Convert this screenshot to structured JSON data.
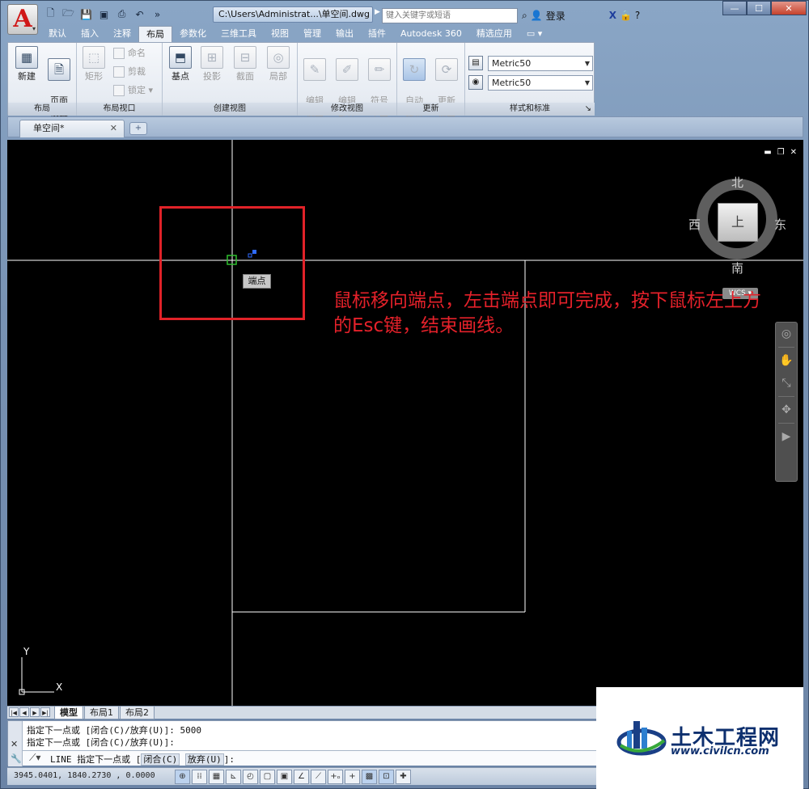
{
  "app": {
    "title": "C:\\Users\\Administrat...\\单空间.dwg",
    "search_placeholder": "键入关键字或短语",
    "login_label": "登录",
    "logo_letter": "A"
  },
  "ribbon_tabs": [
    {
      "label": "默认",
      "active": false
    },
    {
      "label": "插入",
      "active": false
    },
    {
      "label": "注释",
      "active": false
    },
    {
      "label": "布局",
      "active": true
    },
    {
      "label": "参数化",
      "active": false
    },
    {
      "label": "三维工具",
      "active": false
    },
    {
      "label": "视图",
      "active": false
    },
    {
      "label": "管理",
      "active": false
    },
    {
      "label": "输出",
      "active": false
    },
    {
      "label": "插件",
      "active": false
    },
    {
      "label": "Autodesk 360",
      "active": false
    },
    {
      "label": "精选应用",
      "active": false
    }
  ],
  "ribbon": {
    "layout_panel": {
      "title": "布局",
      "new_label": "新建",
      "page_setup_label": "页面\n设置"
    },
    "viewport_panel": {
      "title": "布局视口",
      "rect_label": "矩形",
      "name_label": "命名",
      "clip_label": "剪裁",
      "lock_label": "锁定"
    },
    "create_view_panel": {
      "title": "创建视图",
      "base_label": "基点",
      "projected_label": "投影",
      "section_label": "截面",
      "detail_label": "局部"
    },
    "modify_view_panel": {
      "title": "修改视图",
      "edit_view_label": "编辑\n视图",
      "edit_component_label": "编辑\n部件",
      "symbol_sketch_label": "符号\n草图"
    },
    "update_panel": {
      "title": "更新",
      "auto_update_label": "自动\n更新",
      "update_view_label": "更新\n视图"
    },
    "styles_panel": {
      "title": "样式和标准",
      "combo1": "Metric50",
      "combo2": "Metric50"
    }
  },
  "file_tab": {
    "label": "单空间*"
  },
  "viewcube": {
    "north": "北",
    "south": "南",
    "east": "东",
    "west": "西",
    "face": "上",
    "wcs": "WCS ▾"
  },
  "tooltip": {
    "text": "端点"
  },
  "annotation": {
    "line1": "鼠标移向端点，左击端点即可完成，按下鼠标左上方",
    "line2": "的Esc键，结束画线。"
  },
  "ucs": {
    "x": "X",
    "y": "Y"
  },
  "layout_tabs": [
    {
      "label": "模型",
      "active": true
    },
    {
      "label": "布局1",
      "active": false
    },
    {
      "label": "布局2",
      "active": false
    }
  ],
  "command": {
    "history": [
      "指定下一点或 [闭合(C)/放弃(U)]: 5000",
      "指定下一点或 [闭合(C)/放弃(U)]:"
    ],
    "prompt_prefix": "LINE 指定下一点或 [",
    "option1": "闭合(C)",
    "option2": "放弃(U)",
    "prompt_suffix": "]:"
  },
  "status": {
    "coords": "3945.0401, 1840.2730 , 0.0000"
  },
  "watermark": {
    "title": "土木工程网",
    "url": "www.civilcn.com"
  },
  "colors": {
    "annotation": "#e4212a",
    "canvas": "#000000",
    "lines": "#ffffff",
    "snap_marker": "#2fbf2f"
  }
}
